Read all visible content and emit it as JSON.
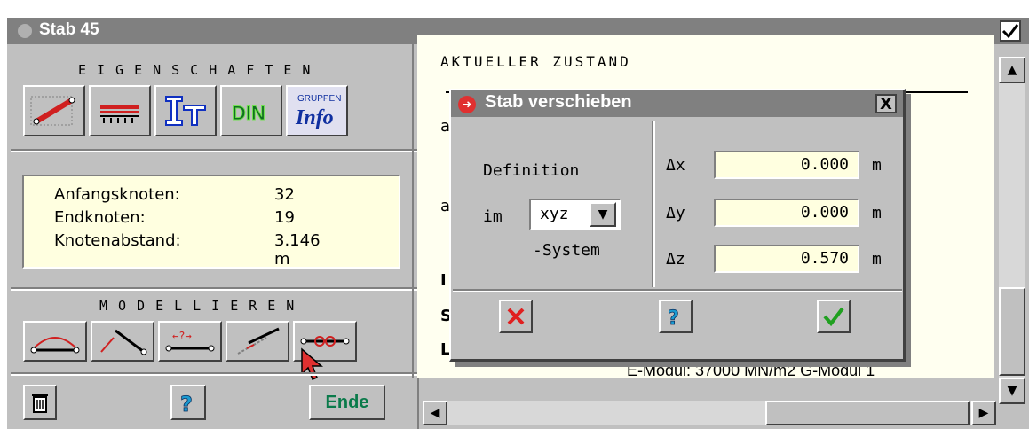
{
  "window": {
    "title": "Stab 45"
  },
  "properties": {
    "heading": "EIGENSCHAFTEN",
    "buttons": [
      {
        "name": "stab-geometry",
        "icon": "bar-line-icon"
      },
      {
        "name": "stab-load",
        "icon": "bar-load-icon"
      },
      {
        "name": "cross-section",
        "icon": "cross-section-icon",
        "label": "IT"
      },
      {
        "name": "din",
        "icon": "din-icon",
        "label": "DIN"
      },
      {
        "name": "group-info",
        "icon": "group-info-icon",
        "label_top": "GRUPPEN",
        "label_bottom": "Info"
      }
    ]
  },
  "info": {
    "rows": [
      {
        "label": "Anfangsknoten:",
        "value": "32"
      },
      {
        "label": "Endknoten:",
        "value": "19"
      },
      {
        "label": "Knotenabstand:",
        "value": "3.146 m"
      }
    ]
  },
  "modelling": {
    "heading": "MODELLIEREN",
    "buttons": [
      "arc-bar-icon",
      "diagonal-bar-icon",
      "measure-bar-icon",
      "move-bar-icon",
      "split-bar-icon"
    ]
  },
  "bottom": {
    "ende_label": "Ende"
  },
  "canvas": {
    "heading": "AKTUELLER ZUSTAND",
    "emodul_line": "E-Modul: 37000 MN/m2   G-Modul 1"
  },
  "dialog": {
    "title": "Stab verschieben",
    "close_label": "X",
    "definition_label": "Definition",
    "im_label": "im",
    "system_select": "xyz",
    "system_label": "-System",
    "deltas": [
      {
        "label": "Δx",
        "value": "0.000",
        "unit": "m"
      },
      {
        "label": "Δy",
        "value": "0.000",
        "unit": "m"
      },
      {
        "label": "Δz",
        "value": "0.570",
        "unit": "m"
      }
    ]
  },
  "colors": {
    "title_bar": "#808080",
    "panel": "#c0c0c0",
    "info_bg": "#ffffe0",
    "canvas_bg": "#fffff0",
    "ende_text": "#0a7a4a"
  }
}
